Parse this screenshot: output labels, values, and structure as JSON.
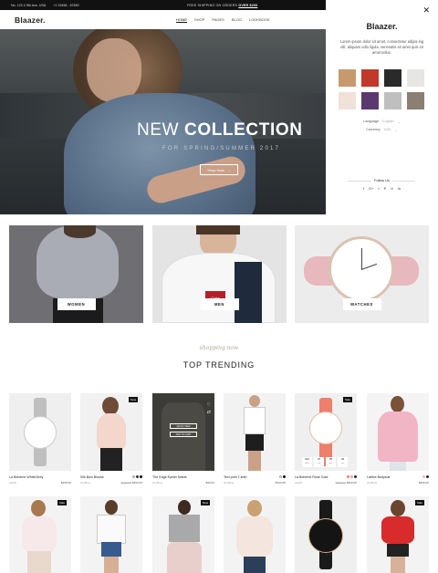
{
  "topbar": {
    "address": "No. 123 X 9th Ave, USA",
    "phone": "+1 23456 - 67890",
    "promo_prefix": "FREE SHIPPING ON ORDERS",
    "promo_link": "OVER $200"
  },
  "header": {
    "logo": "Blaazer.",
    "nav": [
      "HOME",
      "SHOP",
      "PAGES",
      "BLOG",
      "LOOKBOOK"
    ]
  },
  "hero": {
    "headline_light": "NEW",
    "headline_bold": "COLLECTION",
    "subline": "FOR SPRING/SUMMER 2017",
    "button": "Shop Now"
  },
  "panel": {
    "logo": "Blaazer.",
    "description": "Lorem ipsum dolor sit amet, consectetur adipis-ing elit, aliquam odio ligula, venenatis sit amet quis sit amet tellus.",
    "language_label": "Language",
    "language_value": "English",
    "currency_label": "Currency",
    "currency_value": "USD",
    "follow_label": "Follow Us",
    "socials": [
      "f",
      "G+",
      "t",
      "P",
      "V",
      "in"
    ],
    "insta_colors": [
      "#c79a6e",
      "#c0392b",
      "#2a2a2a",
      "#e8e6e3",
      "#f1e1d8",
      "#5a3a6e",
      "#bfbfbf",
      "#8a7f72"
    ]
  },
  "banners": [
    {
      "label": "WOMEN"
    },
    {
      "label": "MEN"
    },
    {
      "label": "WATCHES"
    }
  ],
  "section": {
    "script": "shopping now",
    "title": "TOP TRENDING"
  },
  "products_row1": [
    {
      "name": "La Boheme White/Grey",
      "brand": "watch",
      "price": "$450.00",
      "old": "",
      "badge": ""
    },
    {
      "name": "Silk Bow Blouse",
      "brand": "clothing",
      "price": "$300.00",
      "old": "$450.00",
      "badge": "New"
    },
    {
      "name": "The Edge Eyelet Sweat",
      "brand": "clothing",
      "price": "$90.00",
      "old": "",
      "badge": "",
      "quick1": "QUICK VIEW",
      "quick2": "ADD TO CART"
    },
    {
      "name": "Text print T-shirt",
      "brand": "clothing",
      "price": "$120.00",
      "old": "",
      "badge": ""
    },
    {
      "name": "La Boheme Rose Gold",
      "brand": "watch",
      "price": "$300.00",
      "old": "$450.00",
      "badge": "Sale",
      "timer": [
        {
          "v": "322",
          "u": "days"
        },
        {
          "v": "07",
          "u": "hrs"
        },
        {
          "v": "35",
          "u": "min"
        },
        {
          "v": "46",
          "u": "sec"
        }
      ]
    },
    {
      "name": "Lattice Bodysuit",
      "brand": "clothing",
      "price": "$400.00",
      "old": "",
      "badge": ""
    }
  ],
  "products_row2": [
    {
      "badge": "Sale"
    },
    {
      "badge": ""
    },
    {
      "badge": "New"
    },
    {
      "badge": ""
    },
    {
      "badge": ""
    },
    {
      "badge": "Sale"
    }
  ]
}
